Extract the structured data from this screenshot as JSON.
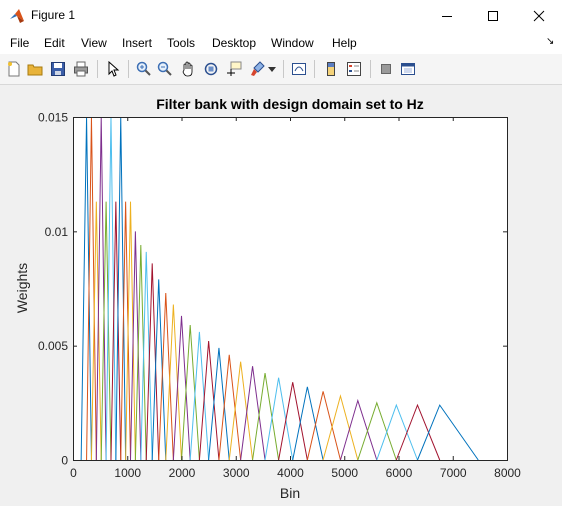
{
  "window": {
    "title": "Figure 1"
  },
  "menu": [
    "File",
    "Edit",
    "View",
    "Insert",
    "Tools",
    "Desktop",
    "Window",
    "Help"
  ],
  "toolbar_icons": [
    "new-figure-icon",
    "open-file-icon",
    "save-icon",
    "print-icon",
    "pointer-icon",
    "zoom-in-icon",
    "zoom-out-icon",
    "pan-icon",
    "rotate-3d-icon",
    "data-cursor-icon",
    "brush-icon",
    "link-plot-icon",
    "colorbar-icon",
    "legend-icon",
    "hide-plot-tools-icon",
    "show-plot-tools-icon"
  ],
  "chart_data": {
    "type": "line",
    "title": "Filter bank with design domain set to Hz",
    "xlabel": "Bin",
    "ylabel": "Weights",
    "xlim": [
      0,
      8000
    ],
    "ylim": [
      0,
      0.015
    ],
    "xticks": [
      "0",
      "1000",
      "2000",
      "3000",
      "4000",
      "5000",
      "6000",
      "7000",
      "8000"
    ],
    "yticks": [
      "0",
      "0.005",
      "0.01",
      "0.015"
    ],
    "grid": false,
    "colors": [
      "#0072BD",
      "#D95319",
      "#EDB120",
      "#7E2F8E",
      "#77AC30",
      "#4DBEEE",
      "#A2142F"
    ],
    "filters": {
      "centers": [
        250,
        340,
        430,
        520,
        610,
        700,
        790,
        880,
        970,
        1060,
        1150,
        1250,
        1350,
        1460,
        1580,
        1710,
        1850,
        2000,
        2160,
        2330,
        2500,
        2690,
        2880,
        3090,
        3310,
        3540,
        3790,
        4050,
        4320,
        4610,
        4930,
        5250,
        5600,
        5960,
        6350,
        6760
      ],
      "edges_first": 150,
      "edges_last": 7470,
      "peaks": [
        0.015,
        0.015,
        0.0113,
        0.015,
        0.0113,
        0.015,
        0.0113,
        0.015,
        0.0113,
        0.0113,
        0.01,
        0.0094,
        0.0091,
        0.0086,
        0.0079,
        0.0073,
        0.0068,
        0.0063,
        0.0059,
        0.0056,
        0.0052,
        0.0049,
        0.0046,
        0.0043,
        0.0041,
        0.0038,
        0.0036,
        0.0034,
        0.0032,
        0.003,
        0.0028,
        0.0026,
        0.0025,
        0.0024,
        0.0024,
        0.0024
      ]
    }
  }
}
